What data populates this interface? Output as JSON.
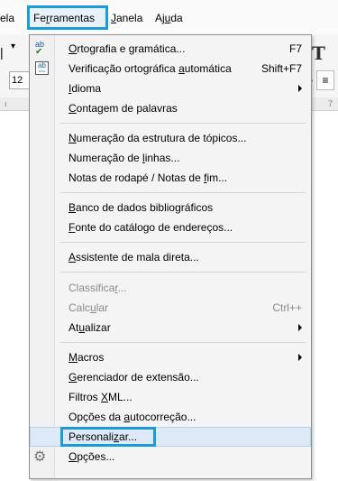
{
  "menubar": {
    "tabela_fragment": "ela",
    "ferramentas": "Ferramentas",
    "janela": "Janela",
    "ajuda": "Ajuda"
  },
  "toolbar": {
    "font_size": "12",
    "ruler_mark_right": "7"
  },
  "menu": {
    "items": [
      {
        "label": "Ortografia e gramática...",
        "shortcut": "F7"
      },
      {
        "label": "Verificação ortográfica automática",
        "shortcut": "Shift+F7"
      },
      {
        "label": "Idioma",
        "submenu": true
      },
      {
        "label": "Contagem de palavras"
      },
      {
        "label": "Numeração da estrutura de tópicos..."
      },
      {
        "label": "Numeração de linhas..."
      },
      {
        "label": "Notas de rodapé / Notas de fim..."
      },
      {
        "label": "Banco de dados bibliográficos"
      },
      {
        "label": "Fonte do catálogo de endereços..."
      },
      {
        "label": "Assistente de mala direta..."
      },
      {
        "label": "Classificar...",
        "disabled": true
      },
      {
        "label": "Calcular",
        "shortcut": "Ctrl++",
        "disabled": true
      },
      {
        "label": "Atualizar",
        "submenu": true
      },
      {
        "label": "Macros",
        "submenu": true
      },
      {
        "label": "Gerenciador de extensão..."
      },
      {
        "label": "Filtros XML..."
      },
      {
        "label": "Opções da autocorreção..."
      },
      {
        "label": "Personalizar...",
        "highlighted": true
      },
      {
        "label": "Opções..."
      }
    ]
  },
  "colors": {
    "highlight_border": "#1b9bd8",
    "hover_bg": "#dde9f7",
    "disabled_text": "#8a8a8a"
  }
}
